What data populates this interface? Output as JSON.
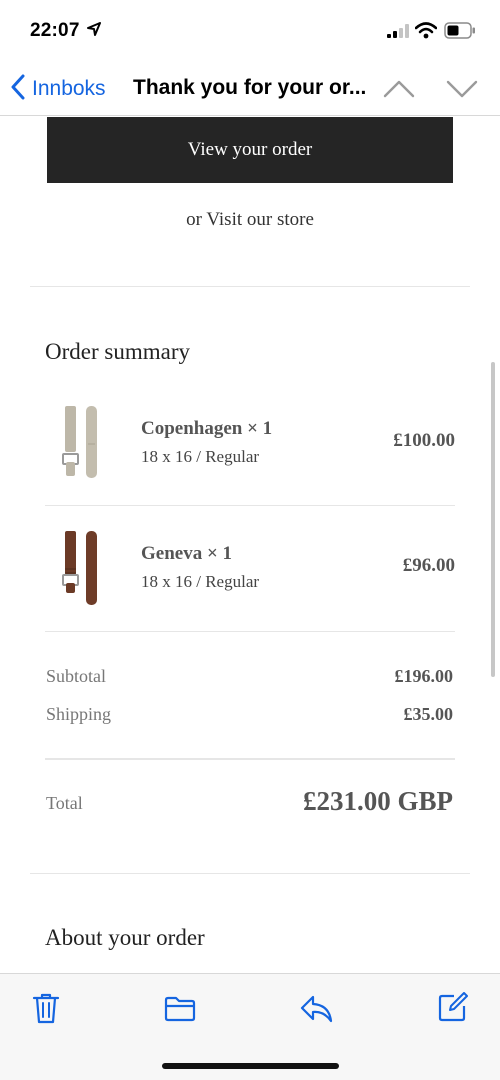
{
  "status_bar": {
    "time": "22:07",
    "location_icon": "location-arrow-icon",
    "signal_icon": "cellular-signal-icon",
    "wifi_icon": "wifi-icon",
    "battery_icon": "battery-icon"
  },
  "nav": {
    "back_label": "Innboks",
    "title": "Thank you for your or...",
    "up_icon": "chevron-up-icon",
    "down_icon": "chevron-down-icon",
    "accent_color": "#1565e0"
  },
  "email": {
    "view_order_label": "View your order",
    "store_prefix": "or",
    "store_link": "Visit our store",
    "order_summary_title": "Order summary",
    "items": [
      {
        "name": "Copenhagen × 1",
        "variant": "18 x 16 / Regular",
        "price": "£100.00",
        "thumb_color": "#b8b2a4"
      },
      {
        "name": "Geneva × 1",
        "variant": "18 x 16 / Regular",
        "price": "£96.00",
        "thumb_color": "#6b3a26"
      }
    ],
    "subtotal_label": "Subtotal",
    "subtotal_value": "£196.00",
    "shipping_label": "Shipping",
    "shipping_value": "£35.00",
    "total_label": "Total",
    "total_value": "£231.00 GBP",
    "about_title": "About your order"
  },
  "toolbar": {
    "trash_icon": "trash-icon",
    "folder_icon": "folder-icon",
    "reply_icon": "reply-icon",
    "compose_icon": "compose-icon"
  }
}
